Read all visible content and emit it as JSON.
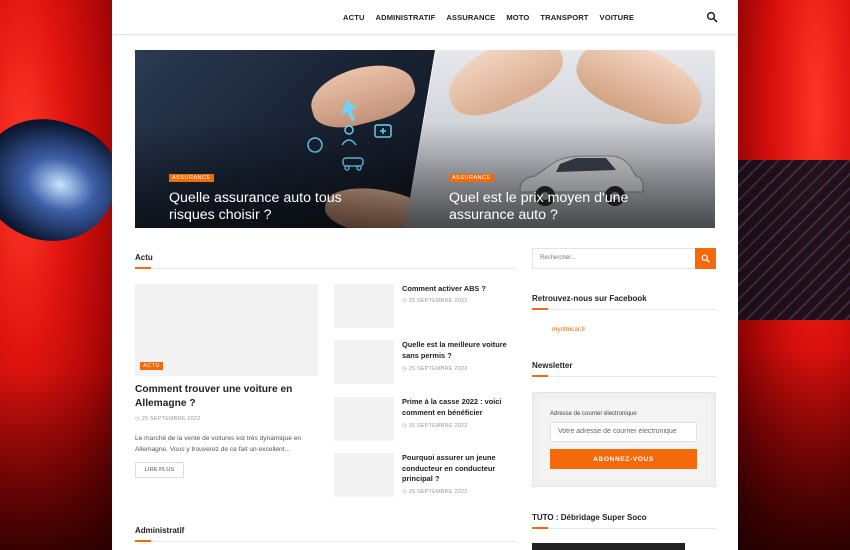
{
  "nav": {
    "items": [
      "ACTU",
      "ADMINISTRATIF",
      "ASSURANCE",
      "MOTO",
      "TRANSPORT",
      "VOITURE"
    ]
  },
  "hero": [
    {
      "tag": "ASSURANCE",
      "title": "Quelle assurance auto tous risques choisir ?"
    },
    {
      "tag": "ASSURANCE",
      "title": "Quel est le prix moyen d'une assurance auto ?"
    }
  ],
  "actu": {
    "section_title": "Actu",
    "featured": {
      "tag": "ACTU",
      "title": "Comment trouver une voiture en Allemagne ?",
      "date": "25 SEPTEMBRE 2022",
      "excerpt": "Le marché de la vente de voitures est très dynamique en Allemagne. Vous y trouverez de ce fait un excellent...",
      "read_more": "LIRE PLUS"
    },
    "list": [
      {
        "title": "Comment activer ABS ?",
        "date": "25 SEPTEMBRE 2022"
      },
      {
        "title": "Quelle est la meilleure voiture sans permis ?",
        "date": "25 SEPTEMBRE 2022"
      },
      {
        "title": "Prime à la casse 2022 : voici comment en bénéficier",
        "date": "25 SEPTEMBRE 2022"
      },
      {
        "title": "Pourquoi assurer un jeune conducteur en conducteur principal ?",
        "date": "25 SEPTEMBRE 2022"
      }
    ]
  },
  "administratif": {
    "section_title": "Administratif"
  },
  "sidebar": {
    "search_placeholder": "Rechercher...",
    "facebook_title": "Retrouvez-nous sur Facebook",
    "facebook_link": "myottocar.fr",
    "newsletter_title": "Newsletter",
    "newsletter_label": "Adresse de courrier électronique",
    "newsletter_placeholder": "Votre adresse de courrier électronique",
    "newsletter_button": "ABONNEZ-VOUS",
    "tuto_title": "TUTO : Débridage Super Soco"
  },
  "colors": {
    "accent": "#f46a0b"
  }
}
